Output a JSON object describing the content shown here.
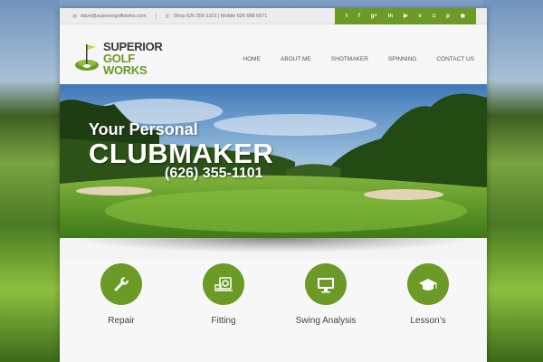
{
  "topbar": {
    "email": "dave@superiorgolfworks.com",
    "phone": "Shop 626 355-1101 | Mobile 626 688 6671",
    "social_icons": [
      "twitter-icon",
      "facebook-icon",
      "google-plus-icon",
      "linkedin-icon",
      "youtube-icon",
      "vimeo-icon",
      "instagram-icon",
      "pinterest-icon",
      "rss-icon"
    ],
    "social_glyphs": [
      "t",
      "f",
      "g+",
      "in",
      "▶",
      "v",
      "◘",
      "p",
      "◉"
    ]
  },
  "logo": {
    "line1": "SUPERIOR",
    "line2": "GOLF WORKS"
  },
  "nav": {
    "items": [
      "HOME",
      "ABOUT ME",
      "SHOTMAKER",
      "SPINNING",
      "CONTACT US"
    ]
  },
  "hero": {
    "line1": "Your Personal",
    "line2": "CLUBMAKER",
    "phone": "(626) 355-1101"
  },
  "services": [
    {
      "label": "Repair",
      "icon": "wrench-icon"
    },
    {
      "label": "Fitting",
      "icon": "fitting-icon"
    },
    {
      "label": "Swing Analysis",
      "icon": "monitor-icon"
    },
    {
      "label": "Lesson’s",
      "icon": "graduation-cap-icon"
    }
  ],
  "colors": {
    "brand_green": "#6b9a26",
    "text_dark": "#3a3a3a"
  }
}
